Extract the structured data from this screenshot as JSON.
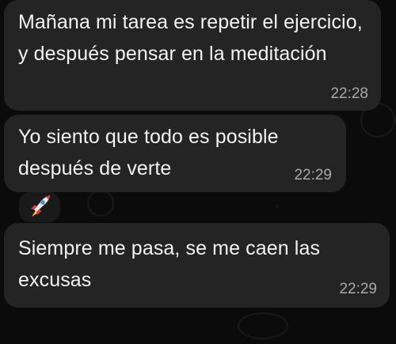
{
  "messages": [
    {
      "text": "Mañana mi tarea es repetir el ejercicio, y después pensar en la meditación",
      "time": "22:28"
    },
    {
      "text": "Yo siento que todo es posible después de verte",
      "time": "22:29"
    },
    {
      "emoji": "rocket-icon"
    },
    {
      "text": "Siempre me pasa, se me caen las excusas",
      "time": "22:29"
    }
  ],
  "colors": {
    "background": "#0b0b0b",
    "bubble": "#242424",
    "text": "#f2f2f2",
    "time": "#a9a9a9"
  }
}
